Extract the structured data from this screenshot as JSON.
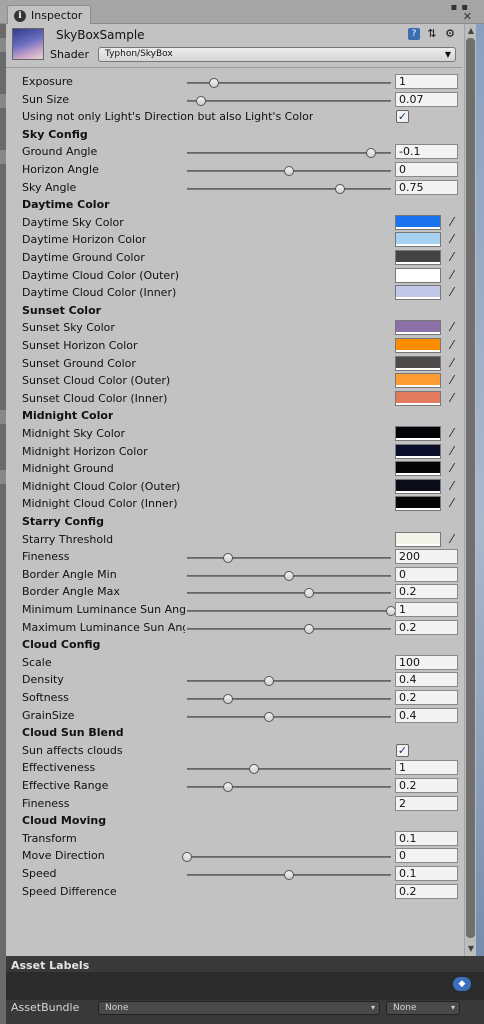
{
  "tab": {
    "title": "Inspector"
  },
  "header": {
    "material_name": "SkyBoxSample",
    "shader_label": "Shader",
    "shader_value": "Typhon/SkyBox"
  },
  "properties": [
    {
      "kind": "slider",
      "label": "Exposure",
      "value": "1",
      "level": 0.13
    },
    {
      "kind": "slider",
      "label": "Sun Size",
      "value": "0.07",
      "level": 0.07
    },
    {
      "kind": "toggle",
      "label": "Using not only Light's Direction but also Light's Color",
      "checked": true
    },
    {
      "kind": "header",
      "label": "Sky Config"
    },
    {
      "kind": "slider",
      "label": "Ground Angle",
      "value": "-0.1",
      "level": 0.9
    },
    {
      "kind": "slider",
      "label": "Horizon Angle",
      "value": "0",
      "level": 0.5
    },
    {
      "kind": "slider",
      "label": "Sky Angle",
      "value": "0.75",
      "level": 0.75
    },
    {
      "kind": "header",
      "label": "Daytime Color"
    },
    {
      "kind": "color",
      "label": "Daytime Sky Color",
      "color": "#1a72ee"
    },
    {
      "kind": "color",
      "label": "Daytime Horizon Color",
      "color": "#a8d2f2"
    },
    {
      "kind": "color",
      "label": "Daytime Ground Color",
      "color": "#434343"
    },
    {
      "kind": "color",
      "label": "Daytime Cloud Color (Outer)",
      "color": "#ffffff"
    },
    {
      "kind": "color",
      "label": "Daytime Cloud Color (Inner)",
      "color": "#c2c9e8"
    },
    {
      "kind": "header",
      "label": "Sunset Color"
    },
    {
      "kind": "color",
      "label": "Sunset Sky Color",
      "color": "#8c71a9"
    },
    {
      "kind": "color",
      "label": "Sunset Horizon Color",
      "color": "#fb8c00"
    },
    {
      "kind": "color",
      "label": "Sunset Ground Color",
      "color": "#4e4a4a"
    },
    {
      "kind": "color",
      "label": "Sunset Cloud Color (Outer)",
      "color": "#ff9b33"
    },
    {
      "kind": "color",
      "label": "Sunset Cloud Color (Inner)",
      "color": "#e27b5e"
    },
    {
      "kind": "header",
      "label": "Midnight Color"
    },
    {
      "kind": "color",
      "label": "Midnight Sky Color",
      "color": "#030308"
    },
    {
      "kind": "color",
      "label": "Midnight Horizon Color",
      "color": "#0b0e2a"
    },
    {
      "kind": "color",
      "label": "Midnight Ground",
      "color": "#050505"
    },
    {
      "kind": "color",
      "label": "Midnight Cloud Color (Outer)",
      "color": "#0a0c18"
    },
    {
      "kind": "color",
      "label": "Midnight Cloud Color (Inner)",
      "color": "#050505"
    },
    {
      "kind": "header",
      "label": "Starry Config"
    },
    {
      "kind": "color",
      "label": "Starry Threshold",
      "color": "#f3f5ea"
    },
    {
      "kind": "slider",
      "label": "Fineness",
      "value": "200",
      "level": 0.2
    },
    {
      "kind": "slider",
      "label": "Border Angle Min",
      "value": "0",
      "level": 0.5
    },
    {
      "kind": "slider",
      "label": "Border Angle Max",
      "value": "0.2",
      "level": 0.6
    },
    {
      "kind": "slider",
      "label": "Minimum Luminance Sun Angle",
      "value": "1",
      "level": 1.0
    },
    {
      "kind": "slider",
      "label": "Maximum Luminance Sun Angle",
      "value": "0.2",
      "level": 0.6
    },
    {
      "kind": "header",
      "label": "Cloud Config"
    },
    {
      "kind": "number",
      "label": "Scale",
      "value": "100"
    },
    {
      "kind": "slider",
      "label": "Density",
      "value": "0.4",
      "level": 0.4
    },
    {
      "kind": "slider",
      "label": "Softness",
      "value": "0.2",
      "level": 0.2
    },
    {
      "kind": "slider",
      "label": "GrainSize",
      "value": "0.4",
      "level": 0.4
    },
    {
      "kind": "header",
      "label": "Cloud Sun Blend"
    },
    {
      "kind": "toggle",
      "label": "Sun affects clouds",
      "checked": true
    },
    {
      "kind": "slider",
      "label": "Effectiveness",
      "value": "1",
      "level": 0.33
    },
    {
      "kind": "slider",
      "label": "Effective Range",
      "value": "0.2",
      "level": 0.2
    },
    {
      "kind": "number",
      "label": "Fineness",
      "value": "2"
    },
    {
      "kind": "header",
      "label": "Cloud Moving"
    },
    {
      "kind": "number",
      "label": "Transform",
      "value": "0.1"
    },
    {
      "kind": "slider",
      "label": "Move Direction",
      "value": "0",
      "level": 0.0
    },
    {
      "kind": "slider",
      "label": "Speed",
      "value": "0.1",
      "level": 0.5
    },
    {
      "kind": "number",
      "label": "Speed Difference",
      "value": "0.2"
    }
  ],
  "asset_labels": {
    "title": "Asset Labels",
    "assetbundle_label": "AssetBundle",
    "bundle_name": "None",
    "bundle_variant": "None"
  },
  "icons": {
    "tab": "info-icon",
    "help": "book-icon",
    "presets": "sliders-icon",
    "settings": "gear-icon",
    "picker": "eyedropper-icon",
    "label_tag": "tag-icon"
  }
}
